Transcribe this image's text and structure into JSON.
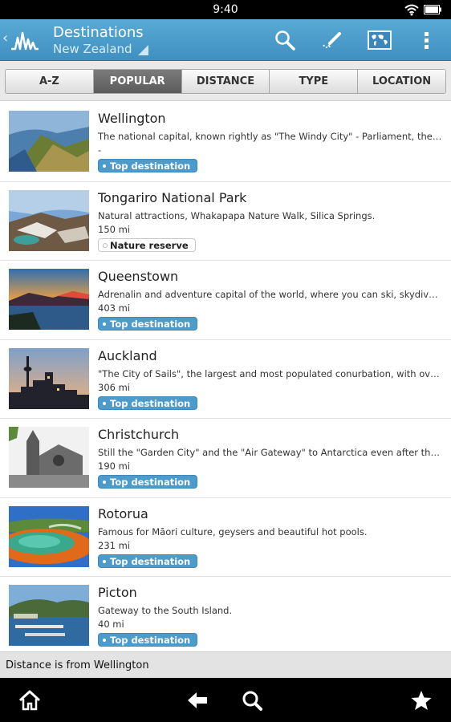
{
  "status": {
    "time": "9:40"
  },
  "header": {
    "title": "Destinations",
    "subtitle": "New Zealand"
  },
  "tabs": [
    {
      "label": "A-Z"
    },
    {
      "label": "POPULAR"
    },
    {
      "label": "DISTANCE"
    },
    {
      "label": "TYPE"
    },
    {
      "label": "LOCATION"
    }
  ],
  "items": [
    {
      "name": "Wellington",
      "description": "The national capital, known rightly as \"The Windy City\" - Parliament, the Beehive, Te Papa and more.",
      "distance": "-",
      "badge": "Top destination"
    },
    {
      "name": "Tongariro National Park",
      "description": "Natural attractions, Whakapapa Nature Walk, Silica Springs.",
      "distance": "150 mi",
      "badge": "Nature reserve"
    },
    {
      "name": "Queenstown",
      "description": "Adrenalin and adventure capital of the world, where you can ski, skydive, bungee jump and more.",
      "distance": "403 mi",
      "badge": "Top destination"
    },
    {
      "name": "Auckland",
      "description": "\"The City of Sails\", the largest and most populated conurbation, with over a million people.",
      "distance": "306 mi",
      "badge": "Top destination"
    },
    {
      "name": "Christchurch",
      "description": "Still the \"Garden City\" and the \"Air Gateway\" to Antarctica even after the recent earthquakes.",
      "distance": "190 mi",
      "badge": "Top destination"
    },
    {
      "name": "Rotorua",
      "description": "Famous for Māori culture, geysers and beautiful hot pools.",
      "distance": "231 mi",
      "badge": "Top destination"
    },
    {
      "name": "Picton",
      "description": "Gateway to the South Island.",
      "distance": "40 mi",
      "badge": "Top destination"
    }
  ],
  "footer": {
    "note": "Distance is from Wellington"
  },
  "colors": {
    "actionbar": "#4b9cca",
    "badge": "#4c9bcb",
    "active_tab": "#6a6a6a"
  },
  "icons": [
    "back-chevron-icon",
    "app-logo-icon",
    "search-icon",
    "draw-icon",
    "map-icon",
    "overflow-menu-icon",
    "home-icon",
    "back-arrow-icon",
    "search-icon",
    "star-icon"
  ]
}
